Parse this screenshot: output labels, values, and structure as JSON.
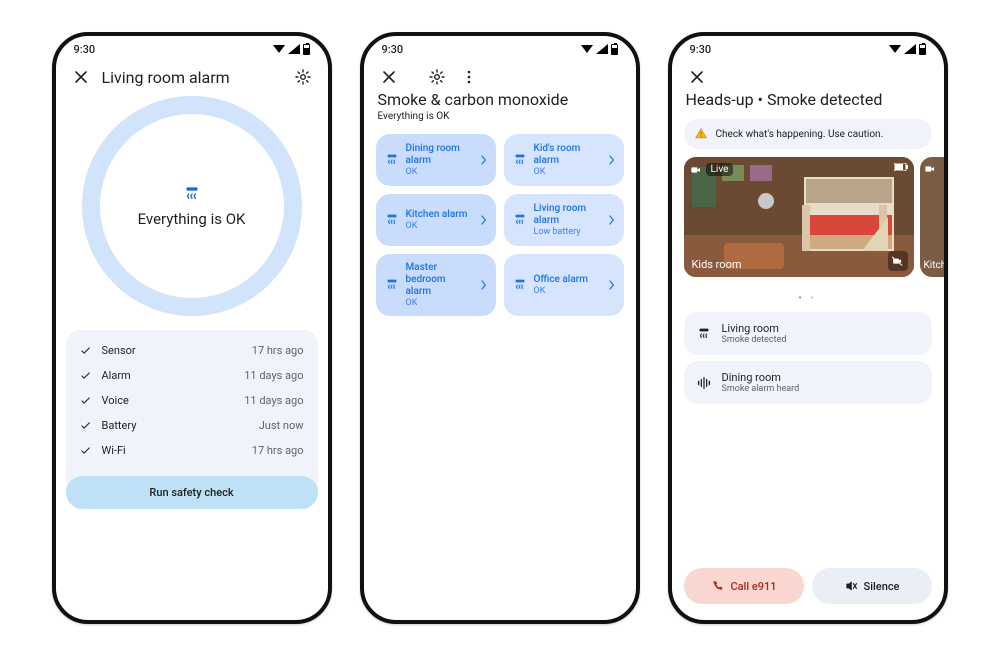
{
  "status_time": "9:30",
  "phone1": {
    "title": "Living room alarm",
    "ring_text": "Everything is OK",
    "checks": [
      {
        "label": "Sensor",
        "time": "17 hrs ago"
      },
      {
        "label": "Alarm",
        "time": "11 days ago"
      },
      {
        "label": "Voice",
        "time": "11 days ago"
      },
      {
        "label": "Battery",
        "time": "Just now"
      },
      {
        "label": "Wi-Fi",
        "time": "17 hrs ago"
      }
    ],
    "safety_btn": "Run safety check"
  },
  "phone2": {
    "title": "Smoke & carbon monoxide",
    "subtitle": "Everything is OK",
    "alarms": [
      {
        "name": "Dining room alarm",
        "status": "OK"
      },
      {
        "name": "Kid's room alarm",
        "status": "OK"
      },
      {
        "name": "Kitchen alarm",
        "status": "OK"
      },
      {
        "name": "Living room alarm",
        "status": "Low battery"
      },
      {
        "name": "Master bedroom alarm",
        "status": "OK"
      },
      {
        "name": "Office alarm",
        "status": "OK"
      }
    ]
  },
  "phone3": {
    "title": "Heads-up • Smoke detected",
    "warning": "Check what's happening. Use caution.",
    "camera": {
      "live": "Live",
      "name": "Kids room",
      "peek_name": "Kitch"
    },
    "detections": [
      {
        "room": "Living room",
        "event": "Smoke detected",
        "icon": "smoke"
      },
      {
        "room": "Dining room",
        "event": "Smoke alarm heard",
        "icon": "sound"
      }
    ],
    "actions": {
      "call": "Call e911",
      "silence": "Silence"
    }
  }
}
